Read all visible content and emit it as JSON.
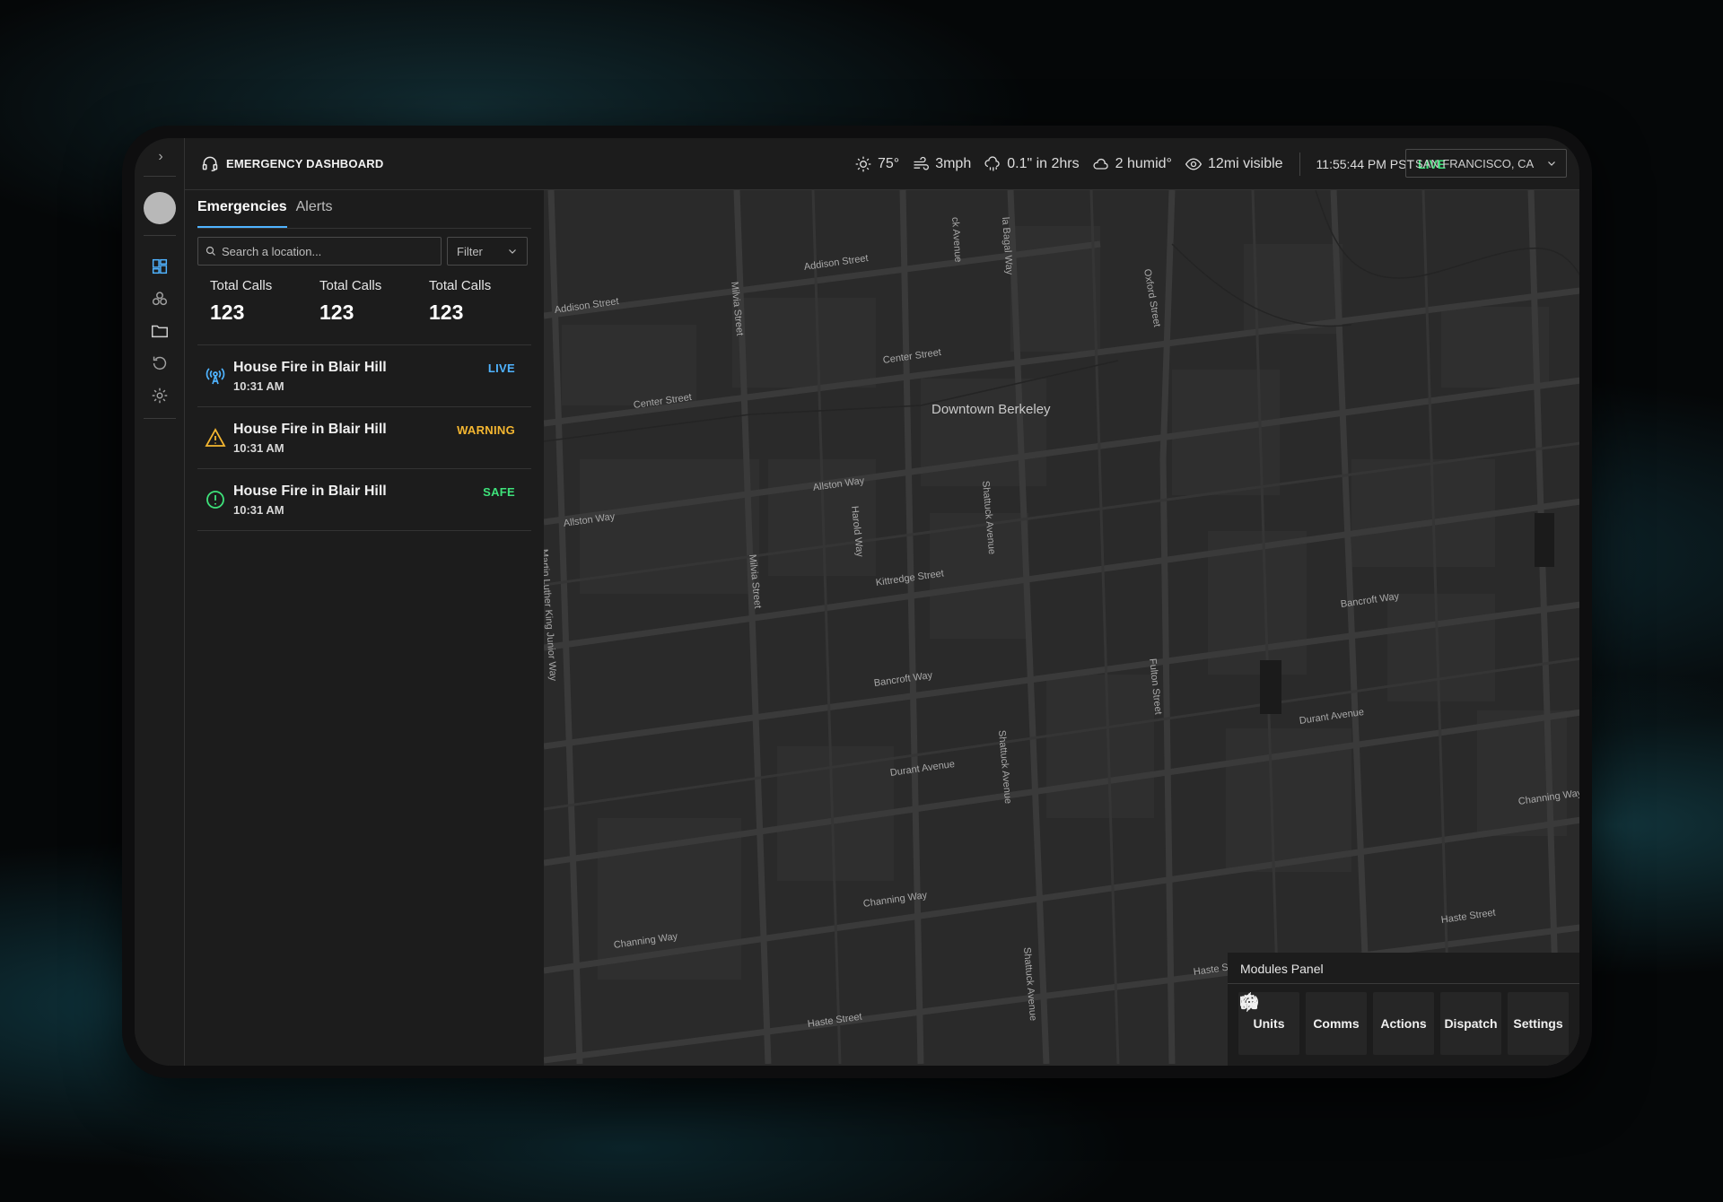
{
  "header": {
    "title": "EMERGENCY DASHBOARD",
    "weather": {
      "temperature": "75°",
      "wind": "3mph",
      "rain": "0.1\" in 2hrs",
      "humidity": "2 humid°",
      "visibility": "12mi visible"
    },
    "time": "11:55:44 PM PST",
    "live_label": "LIVE",
    "location": "SAN FRANCISCO, CA"
  },
  "panel": {
    "tabs": [
      "Emergencies",
      "Alerts"
    ],
    "search_placeholder": "Search a location...",
    "filter_label": "Filter",
    "stats": [
      {
        "label": "Total Calls",
        "value": "123"
      },
      {
        "label": "Total Calls",
        "value": "123"
      },
      {
        "label": "Total Calls",
        "value": "123"
      }
    ],
    "incidents": [
      {
        "title": "House Fire in Blair Hill",
        "time": "10:31 AM",
        "status": "LIVE",
        "status_color": "#4fb3ff",
        "icon": "broadcast-icon"
      },
      {
        "title": "House Fire in Blair Hill",
        "time": "10:31 AM",
        "status": "WARNING",
        "status_color": "#f5b731",
        "icon": "warning-icon"
      },
      {
        "title": "House Fire in Blair Hill",
        "time": "10:31 AM",
        "status": "SAFE",
        "status_color": "#3ee27a",
        "icon": "alert-circle-icon"
      }
    ]
  },
  "map": {
    "area_label": "Downtown Berkeley",
    "street_labels": [
      "Addison Street",
      "Addison Street",
      "Center Street",
      "Center Street",
      "Allston Way",
      "Allston Way",
      "Kittredge Street",
      "Bancroft Way",
      "Bancroft Way",
      "Durant Avenue",
      "Durant Avenue",
      "Channing Way",
      "Channing Way",
      "Channing Way",
      "Haste Street",
      "Haste Street",
      "Haste S",
      "Milvia Street",
      "Milvia Street",
      "Harold Way",
      "Shattuck Avenue",
      "Shattuck Avenue",
      "Shattuck Avenue",
      "Oxford Street",
      "Fulton Street",
      "la Bagal Way",
      "ck Avenue",
      "Martin Luther King Junior Way"
    ]
  },
  "modules": {
    "title": "Modules Panel",
    "buttons": [
      {
        "label": "Units",
        "icon": "truck-icon"
      },
      {
        "label": "Comms",
        "icon": "radio-icon"
      },
      {
        "label": "Actions",
        "icon": "lightning-icon"
      },
      {
        "label": "Dispatch",
        "icon": "headset-icon"
      },
      {
        "label": "Settings",
        "icon": "gear-icon"
      }
    ]
  },
  "colors": {
    "accent": "#4fb3ff",
    "live": "#3ee27a",
    "warning": "#f5b731",
    "safe": "#3ee27a"
  }
}
